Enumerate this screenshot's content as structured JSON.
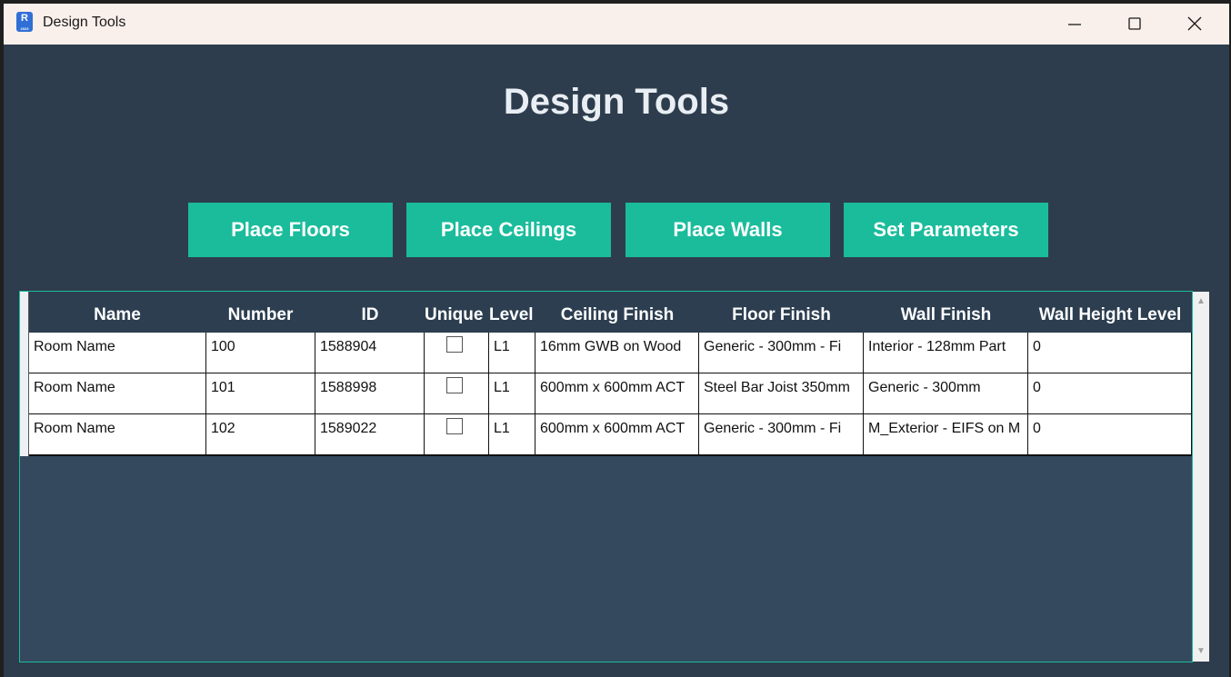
{
  "window": {
    "title": "Design Tools",
    "app_icon": {
      "letter": "R",
      "sub": "2023",
      "name": "revit-icon"
    },
    "controls": [
      "minimize-icon",
      "maximize-icon",
      "close-icon"
    ]
  },
  "heading": "Design Tools",
  "toolbar": {
    "place_floors": "Place Floors",
    "place_ceilings": "Place Ceilings",
    "place_walls": "Place Walls",
    "set_parameters": "Set Parameters"
  },
  "grid": {
    "columns": [
      "Name",
      "Number",
      "ID",
      "Unique",
      "Level",
      "Ceiling Finish",
      "Floor Finish",
      "Wall Finish",
      "Wall Height Level"
    ],
    "rows": [
      {
        "name": "Room Name",
        "number": "100",
        "id": "1588904",
        "unique": false,
        "level": "L1",
        "ceiling": "16mm GWB on Wood",
        "floor": "Generic - 300mm - Fi",
        "wall": "Interior - 128mm Part",
        "height": "0"
      },
      {
        "name": "Room Name",
        "number": "101",
        "id": "1588998",
        "unique": false,
        "level": "L1",
        "ceiling": "600mm x 600mm ACT",
        "floor": "Steel Bar Joist 350mm",
        "wall": "Generic - 300mm",
        "height": "0"
      },
      {
        "name": "Room Name",
        "number": "102",
        "id": "1589022",
        "unique": false,
        "level": "L1",
        "ceiling": "600mm x 600mm ACT",
        "floor": "Generic - 300mm - Fi",
        "wall": "M_Exterior - EIFS on M",
        "height": "0"
      }
    ]
  },
  "colors": {
    "background": "#2e3d4d",
    "accent": "#1abc9c",
    "header": "#2c3e50",
    "titlebar": "#f9efeb"
  }
}
